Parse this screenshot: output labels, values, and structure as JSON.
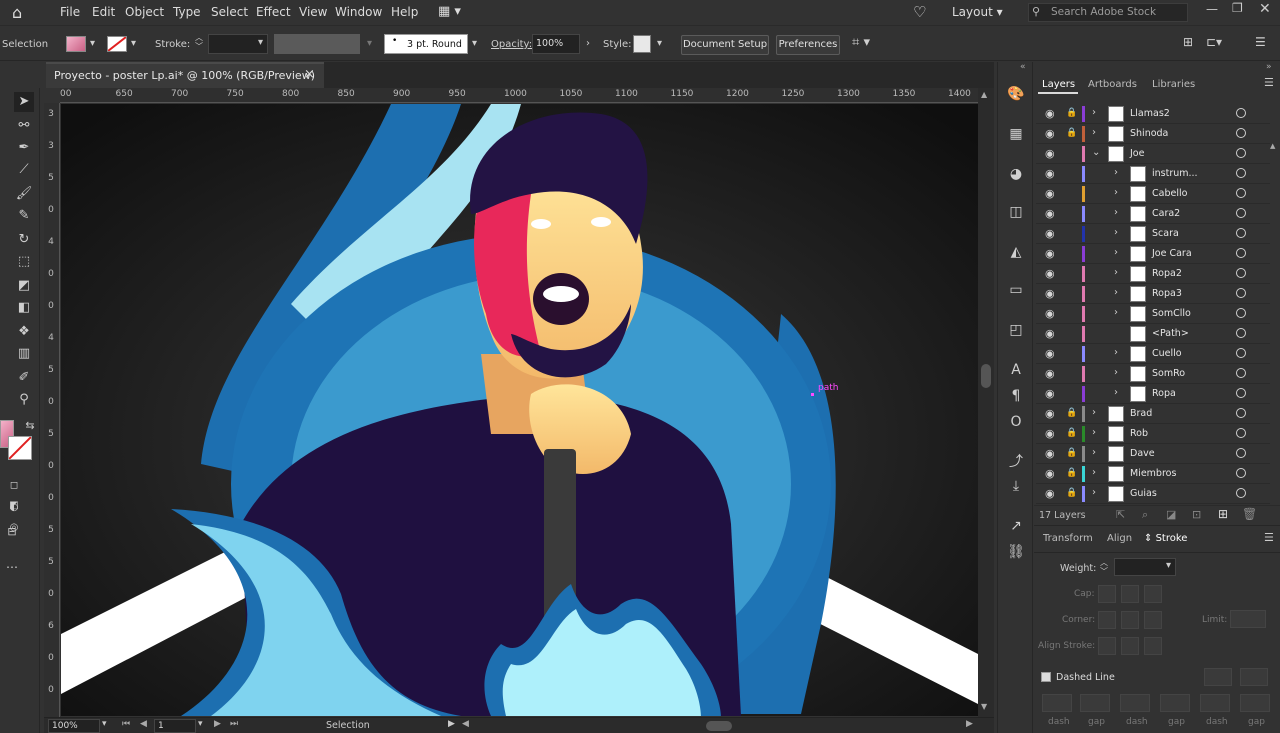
{
  "menubar": {
    "items": [
      "File",
      "Edit",
      "Object",
      "Type",
      "Select",
      "Effect",
      "View",
      "Window",
      "Help"
    ],
    "workspace": "Layout",
    "search_placeholder": "Search Adobe Stock"
  },
  "controlbar": {
    "selection_label": "Selection",
    "stroke_label": "Stroke:",
    "brush_value": "3 pt. Round",
    "opacity_label": "Opacity:",
    "opacity_value": "100%",
    "style_label": "Style:",
    "document_setup": "Document Setup",
    "preferences": "Preferences"
  },
  "document_tab": {
    "title": "Proyecto - poster Lp.ai* @ 100% (RGB/Preview)",
    "close": "×"
  },
  "ruler": {
    "h_ticks": [
      "00",
      "650",
      "700",
      "750",
      "800",
      "850",
      "900",
      "950",
      "1000",
      "1050",
      "1100",
      "1150",
      "1200",
      "1250",
      "1300",
      "1350",
      "1400"
    ],
    "v_ticks": [
      "3",
      "3",
      "5",
      "0",
      "4",
      "0",
      "0",
      "4",
      "5",
      "0",
      "5",
      "0",
      "0",
      "5",
      "5",
      "0",
      "6",
      "0",
      "0"
    ]
  },
  "canvas": {
    "path_label": "path"
  },
  "status": {
    "zoom": "100%",
    "artboard": "1",
    "tool": "Selection"
  },
  "layers_panel": {
    "tabs": [
      "Layers",
      "Artboards",
      "Libraries"
    ],
    "count_label": "17 Layers",
    "rows": [
      {
        "name": "Llamas2",
        "color": "#8a3dd6",
        "locked": true,
        "level": 0,
        "expanded": false,
        "hasArrow": true
      },
      {
        "name": "Shinoda",
        "color": "#c0603a",
        "locked": true,
        "level": 0,
        "expanded": false,
        "hasArrow": true
      },
      {
        "name": "Joe",
        "color": "#e07ab0",
        "locked": false,
        "level": 0,
        "expanded": true,
        "hasArrow": true
      },
      {
        "name": "instrum...",
        "color": "#8a8aff",
        "locked": false,
        "level": 1,
        "expanded": false,
        "hasArrow": true
      },
      {
        "name": "Cabello",
        "color": "#e0a030",
        "locked": false,
        "level": 1,
        "expanded": false,
        "hasArrow": true
      },
      {
        "name": "Cara2",
        "color": "#8a8aff",
        "locked": false,
        "level": 1,
        "expanded": false,
        "hasArrow": true
      },
      {
        "name": "Scara",
        "color": "#2233aa",
        "locked": false,
        "level": 1,
        "expanded": false,
        "hasArrow": true
      },
      {
        "name": "Joe Cara",
        "color": "#8a3dd6",
        "locked": false,
        "level": 1,
        "expanded": false,
        "hasArrow": true
      },
      {
        "name": "Ropa2",
        "color": "#e07ab0",
        "locked": false,
        "level": 1,
        "expanded": false,
        "hasArrow": true
      },
      {
        "name": "Ropa3",
        "color": "#e07ab0",
        "locked": false,
        "level": 1,
        "expanded": false,
        "hasArrow": true
      },
      {
        "name": "SomCllo",
        "color": "#e07ab0",
        "locked": false,
        "level": 1,
        "expanded": false,
        "hasArrow": true
      },
      {
        "name": "<Path>",
        "color": "#e07ab0",
        "locked": false,
        "level": 1,
        "expanded": false,
        "hasArrow": false
      },
      {
        "name": "Cuello",
        "color": "#8a8aff",
        "locked": false,
        "level": 1,
        "expanded": false,
        "hasArrow": true
      },
      {
        "name": "SomRo",
        "color": "#e07ab0",
        "locked": false,
        "level": 1,
        "expanded": false,
        "hasArrow": true
      },
      {
        "name": "Ropa",
        "color": "#8a3dd6",
        "locked": false,
        "level": 1,
        "expanded": false,
        "hasArrow": true
      },
      {
        "name": "Brad",
        "color": "#8a8a8a",
        "locked": true,
        "level": 0,
        "expanded": false,
        "hasArrow": true
      },
      {
        "name": "Rob",
        "color": "#2a8a2a",
        "locked": true,
        "level": 0,
        "expanded": false,
        "hasArrow": true
      },
      {
        "name": "Dave",
        "color": "#8a8a8a",
        "locked": true,
        "level": 0,
        "expanded": false,
        "hasArrow": true
      },
      {
        "name": "Miembros",
        "color": "#3ad6d6",
        "locked": true,
        "level": 0,
        "expanded": false,
        "hasArrow": true
      },
      {
        "name": "Guias",
        "color": "#8a8aff",
        "locked": true,
        "level": 0,
        "expanded": false,
        "hasArrow": true
      }
    ]
  },
  "stroke_panel": {
    "tabs": [
      "Transform",
      "Align",
      "Stroke"
    ],
    "weight_label": "Weight:",
    "cap_label": "Cap:",
    "corner_label": "Corner:",
    "limit_label": "Limit:",
    "align_stroke_label": "Align Stroke:",
    "dashed_line_label": "Dashed Line",
    "dash_labels": [
      "dash",
      "gap",
      "dash",
      "gap",
      "dash",
      "gap"
    ]
  }
}
